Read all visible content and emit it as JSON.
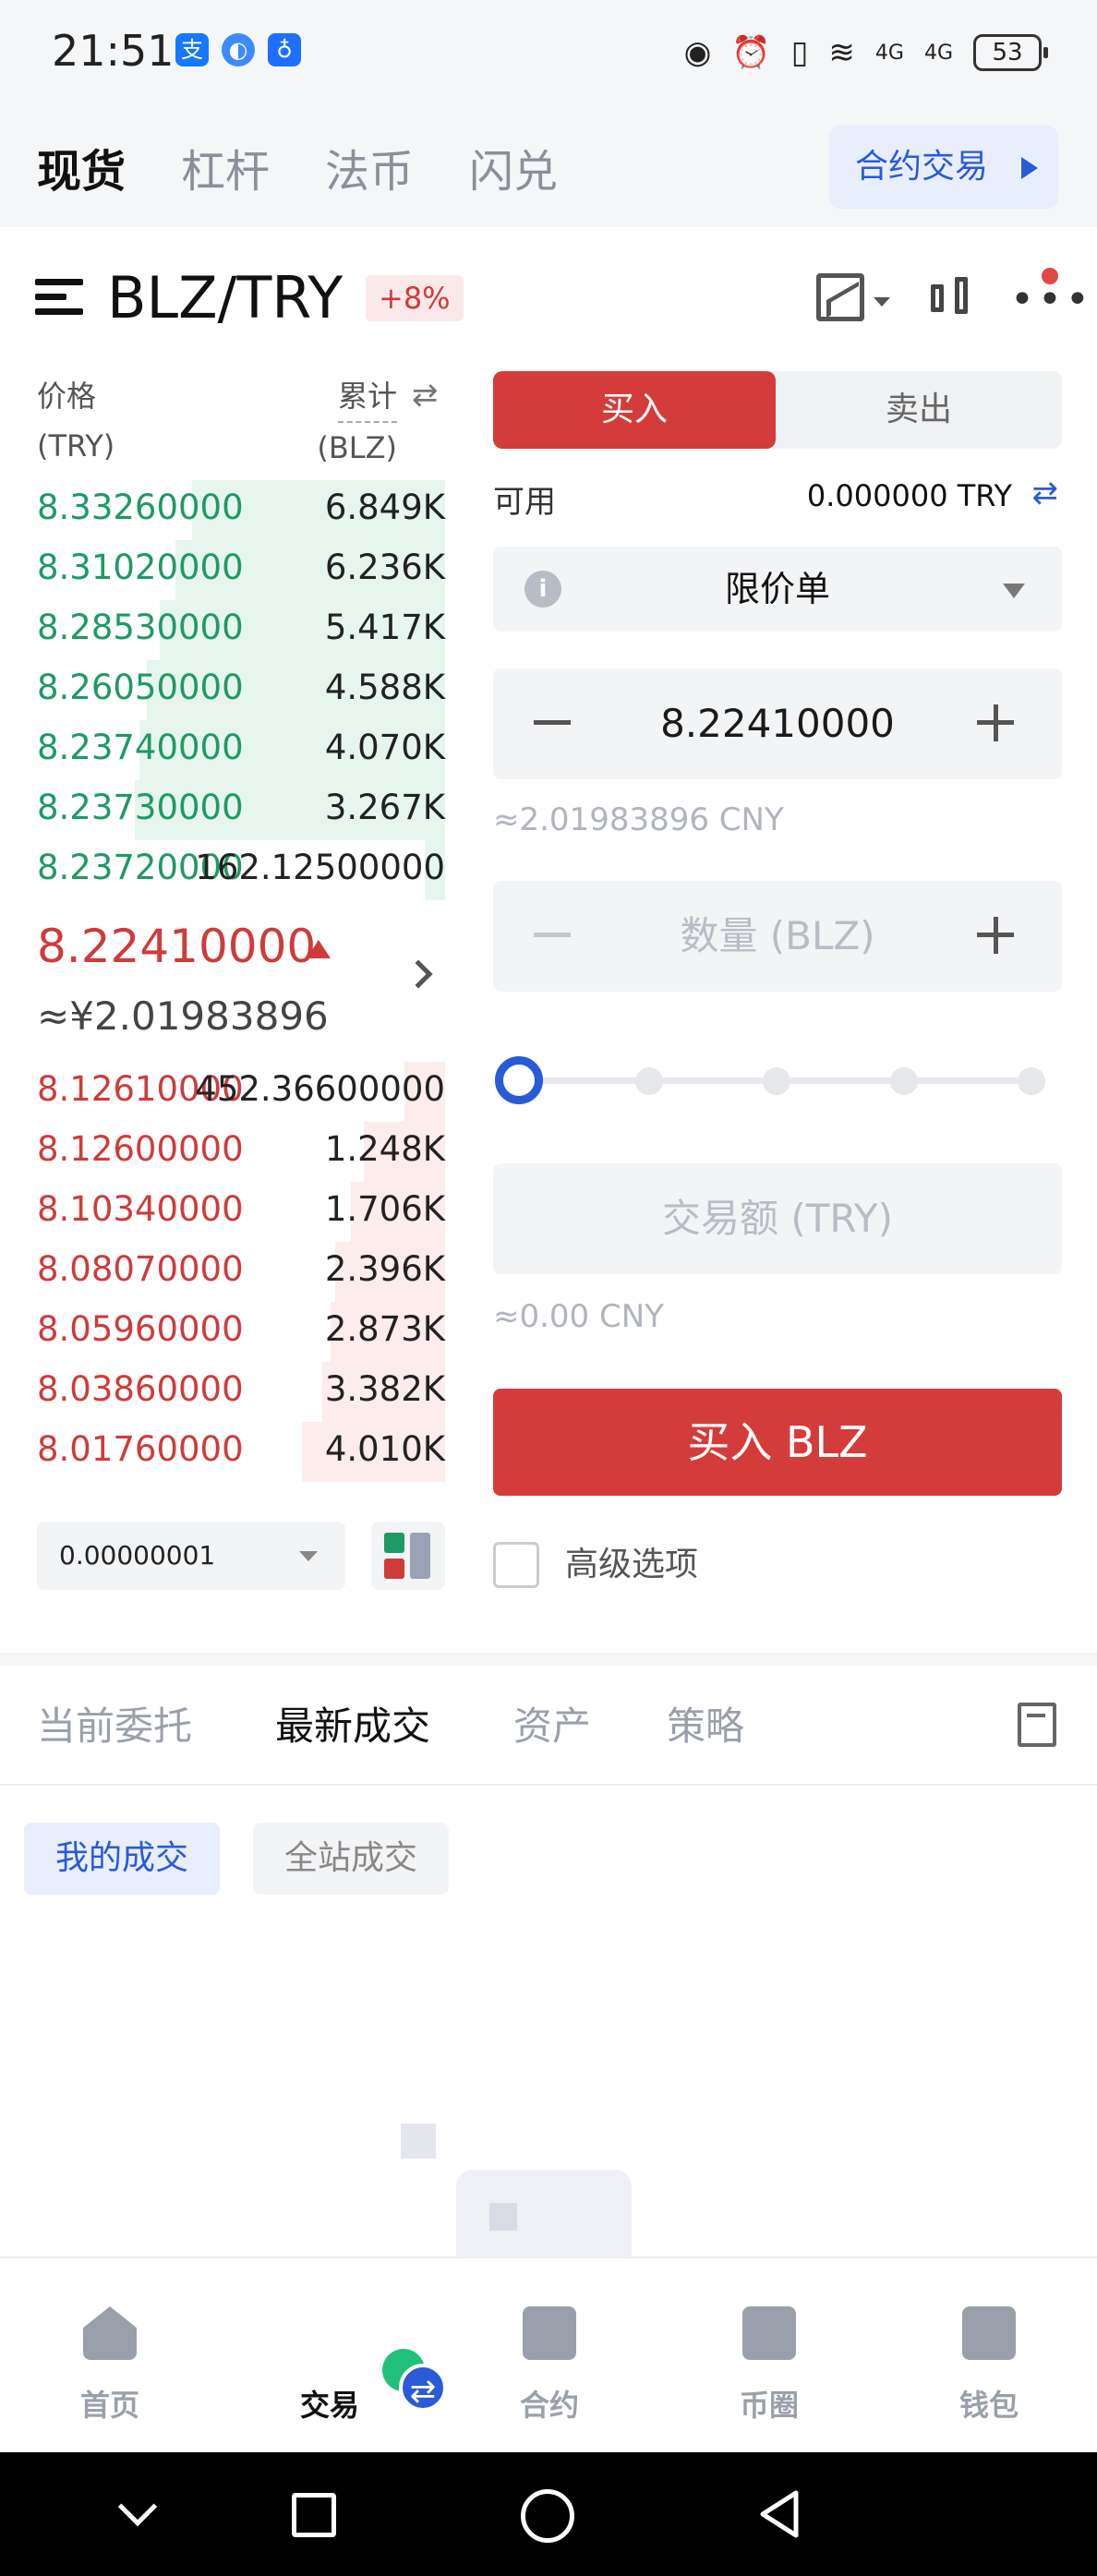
{
  "status_bar": {
    "time": "21:51",
    "battery": "53",
    "network": [
      "4G",
      "4G"
    ]
  },
  "top_tabs": [
    {
      "label": "现货",
      "active": true
    },
    {
      "label": "杠杆",
      "active": false
    },
    {
      "label": "法币",
      "active": false
    },
    {
      "label": "闪兑",
      "active": false
    }
  ],
  "contract_button": "合约交易",
  "pair": {
    "name": "BLZ/TRY",
    "change": "+8%"
  },
  "order_book": {
    "price_header": "价格",
    "price_unit": "(TRY)",
    "total_header": "累计",
    "total_unit": "(BLZ)",
    "asks": [
      {
        "price": "8.33260000",
        "qty": "6.849K",
        "depth": 0.62
      },
      {
        "price": "8.31020000",
        "qty": "6.236K",
        "depth": 0.66
      },
      {
        "price": "8.28530000",
        "qty": "5.417K",
        "depth": 0.7
      },
      {
        "price": "8.26050000",
        "qty": "4.588K",
        "depth": 0.73
      },
      {
        "price": "8.23740000",
        "qty": "4.070K",
        "depth": 0.75
      },
      {
        "price": "8.23730000",
        "qty": "3.267K",
        "depth": 0.76
      },
      {
        "price": "8.23720000",
        "qty": "162.12500000",
        "depth": 0.05
      }
    ],
    "last_price": "8.22410000",
    "last_price_cny": "≈¥2.01983896",
    "bids": [
      {
        "price": "8.12610000",
        "qty": "452.36600000",
        "depth": 0.1
      },
      {
        "price": "8.12600000",
        "qty": "1.248K",
        "depth": 0.2
      },
      {
        "price": "8.10340000",
        "qty": "1.706K",
        "depth": 0.23
      },
      {
        "price": "8.08070000",
        "qty": "2.396K",
        "depth": 0.27
      },
      {
        "price": "8.05960000",
        "qty": "2.873K",
        "depth": 0.28
      },
      {
        "price": "8.03860000",
        "qty": "3.382K",
        "depth": 0.3
      },
      {
        "price": "8.01760000",
        "qty": "4.010K",
        "depth": 0.35
      }
    ],
    "precision": "0.00000001"
  },
  "order_form": {
    "buy_label": "买入",
    "sell_label": "卖出",
    "available_label": "可用",
    "available_value": "0.000000 TRY",
    "order_type": "限价单",
    "price_value": "8.22410000",
    "price_cny": "≈2.01983896 CNY",
    "quantity_placeholder": "数量 (BLZ)",
    "amount_placeholder": "交易额 (TRY)",
    "amount_cny": "≈0.00 CNY",
    "slider_percent": 0,
    "submit_label": "买入 BLZ",
    "advanced_label": "高级选项"
  },
  "bottom_tabs": [
    {
      "label": "当前委托",
      "active": false
    },
    {
      "label": "最新成交",
      "active": true
    },
    {
      "label": "资产",
      "active": false
    },
    {
      "label": "策略",
      "active": false
    }
  ],
  "trade_filters": {
    "mine": "我的成交",
    "all": "全站成交"
  },
  "bottom_nav": [
    {
      "label": "首页",
      "icon": "home-icon",
      "active": false
    },
    {
      "label": "交易",
      "icon": "trade-icon",
      "active": true
    },
    {
      "label": "合约",
      "icon": "contract-icon",
      "active": false
    },
    {
      "label": "币圈",
      "icon": "community-icon",
      "active": false
    },
    {
      "label": "钱包",
      "icon": "wallet-icon",
      "active": false
    }
  ],
  "colors": {
    "buy": "#d43c3c",
    "ask": "#1f9a63",
    "accent": "#2a5bd7"
  }
}
